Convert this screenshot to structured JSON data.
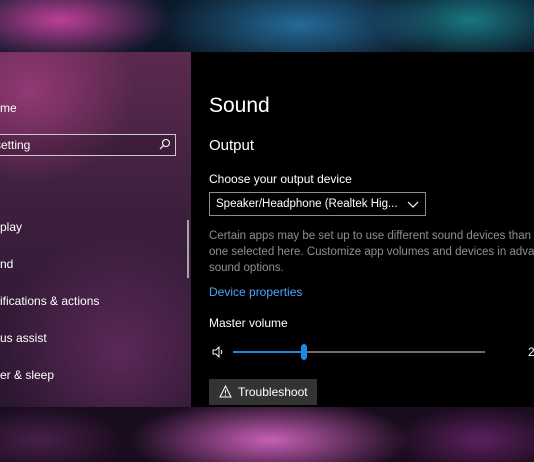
{
  "sidebar": {
    "home_label": "me",
    "search": {
      "value": "",
      "placeholder": "setting",
      "icon": "search-icon"
    },
    "items": [
      {
        "label": "play",
        "icon": "display-icon"
      },
      {
        "label": "nd",
        "icon": "sound-icon"
      },
      {
        "label": "ifications & actions",
        "icon": "notifications-icon"
      },
      {
        "label": "us assist",
        "icon": "focus-assist-icon"
      },
      {
        "label": "er & sleep",
        "icon": "power-icon"
      }
    ]
  },
  "window": {
    "controls": [
      "minimize"
    ]
  },
  "main": {
    "title": "Sound",
    "output": {
      "heading": "Output",
      "device_label": "Choose your output device",
      "device_selected": "Speaker/Headphone (Realtek Hig...",
      "description_lines": [
        "Certain apps may be set up to use different sound devices than",
        "one selected here. Customize app volumes and devices in advar",
        "sound options."
      ],
      "device_properties_link": "Device properties",
      "master_volume_label": "Master volume",
      "master_volume_display": "2",
      "volume_fraction": 0.28,
      "troubleshoot_label": "Troubleshoot"
    }
  },
  "colors": {
    "accent": "#1e88e5",
    "link": "#4ea3ff",
    "description_text": "#8f8f8f",
    "button_bg": "#333333"
  }
}
